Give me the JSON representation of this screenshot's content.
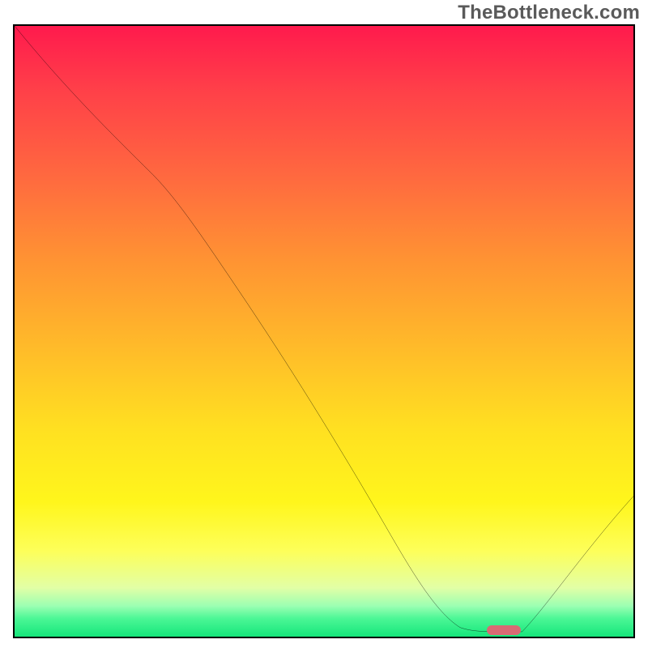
{
  "watermark": "TheBottleneck.com",
  "chart_data": {
    "type": "line",
    "title": "",
    "xlabel": "",
    "ylabel": "",
    "xlim": [
      0,
      100
    ],
    "ylim": [
      0,
      100
    ],
    "grid": false,
    "series": [
      {
        "name": "curve",
        "x": [
          0,
          22,
          68,
          76,
          82,
          100
        ],
        "values": [
          100,
          76,
          4,
          1,
          1,
          23
        ]
      }
    ],
    "annotations": [
      {
        "name": "marker-pill",
        "x": 79,
        "y": 1
      }
    ],
    "background": "vertical-gradient red→yellow→green"
  }
}
